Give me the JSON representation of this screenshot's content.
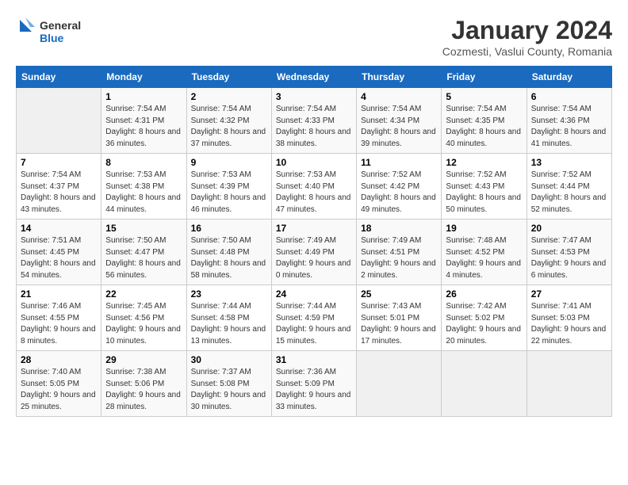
{
  "header": {
    "logo_general": "General",
    "logo_blue": "Blue",
    "title": "January 2024",
    "subtitle": "Cozmesti, Vaslui County, Romania"
  },
  "days_of_week": [
    "Sunday",
    "Monday",
    "Tuesday",
    "Wednesday",
    "Thursday",
    "Friday",
    "Saturday"
  ],
  "weeks": [
    [
      {
        "day": "",
        "sunrise": "",
        "sunset": "",
        "daylight": "",
        "empty": true
      },
      {
        "day": "1",
        "sunrise": "Sunrise: 7:54 AM",
        "sunset": "Sunset: 4:31 PM",
        "daylight": "Daylight: 8 hours and 36 minutes."
      },
      {
        "day": "2",
        "sunrise": "Sunrise: 7:54 AM",
        "sunset": "Sunset: 4:32 PM",
        "daylight": "Daylight: 8 hours and 37 minutes."
      },
      {
        "day": "3",
        "sunrise": "Sunrise: 7:54 AM",
        "sunset": "Sunset: 4:33 PM",
        "daylight": "Daylight: 8 hours and 38 minutes."
      },
      {
        "day": "4",
        "sunrise": "Sunrise: 7:54 AM",
        "sunset": "Sunset: 4:34 PM",
        "daylight": "Daylight: 8 hours and 39 minutes."
      },
      {
        "day": "5",
        "sunrise": "Sunrise: 7:54 AM",
        "sunset": "Sunset: 4:35 PM",
        "daylight": "Daylight: 8 hours and 40 minutes."
      },
      {
        "day": "6",
        "sunrise": "Sunrise: 7:54 AM",
        "sunset": "Sunset: 4:36 PM",
        "daylight": "Daylight: 8 hours and 41 minutes."
      }
    ],
    [
      {
        "day": "7",
        "sunrise": "Sunrise: 7:54 AM",
        "sunset": "Sunset: 4:37 PM",
        "daylight": "Daylight: 8 hours and 43 minutes."
      },
      {
        "day": "8",
        "sunrise": "Sunrise: 7:53 AM",
        "sunset": "Sunset: 4:38 PM",
        "daylight": "Daylight: 8 hours and 44 minutes."
      },
      {
        "day": "9",
        "sunrise": "Sunrise: 7:53 AM",
        "sunset": "Sunset: 4:39 PM",
        "daylight": "Daylight: 8 hours and 46 minutes."
      },
      {
        "day": "10",
        "sunrise": "Sunrise: 7:53 AM",
        "sunset": "Sunset: 4:40 PM",
        "daylight": "Daylight: 8 hours and 47 minutes."
      },
      {
        "day": "11",
        "sunrise": "Sunrise: 7:52 AM",
        "sunset": "Sunset: 4:42 PM",
        "daylight": "Daylight: 8 hours and 49 minutes."
      },
      {
        "day": "12",
        "sunrise": "Sunrise: 7:52 AM",
        "sunset": "Sunset: 4:43 PM",
        "daylight": "Daylight: 8 hours and 50 minutes."
      },
      {
        "day": "13",
        "sunrise": "Sunrise: 7:52 AM",
        "sunset": "Sunset: 4:44 PM",
        "daylight": "Daylight: 8 hours and 52 minutes."
      }
    ],
    [
      {
        "day": "14",
        "sunrise": "Sunrise: 7:51 AM",
        "sunset": "Sunset: 4:45 PM",
        "daylight": "Daylight: 8 hours and 54 minutes."
      },
      {
        "day": "15",
        "sunrise": "Sunrise: 7:50 AM",
        "sunset": "Sunset: 4:47 PM",
        "daylight": "Daylight: 8 hours and 56 minutes."
      },
      {
        "day": "16",
        "sunrise": "Sunrise: 7:50 AM",
        "sunset": "Sunset: 4:48 PM",
        "daylight": "Daylight: 8 hours and 58 minutes."
      },
      {
        "day": "17",
        "sunrise": "Sunrise: 7:49 AM",
        "sunset": "Sunset: 4:49 PM",
        "daylight": "Daylight: 9 hours and 0 minutes."
      },
      {
        "day": "18",
        "sunrise": "Sunrise: 7:49 AM",
        "sunset": "Sunset: 4:51 PM",
        "daylight": "Daylight: 9 hours and 2 minutes."
      },
      {
        "day": "19",
        "sunrise": "Sunrise: 7:48 AM",
        "sunset": "Sunset: 4:52 PM",
        "daylight": "Daylight: 9 hours and 4 minutes."
      },
      {
        "day": "20",
        "sunrise": "Sunrise: 7:47 AM",
        "sunset": "Sunset: 4:53 PM",
        "daylight": "Daylight: 9 hours and 6 minutes."
      }
    ],
    [
      {
        "day": "21",
        "sunrise": "Sunrise: 7:46 AM",
        "sunset": "Sunset: 4:55 PM",
        "daylight": "Daylight: 9 hours and 8 minutes."
      },
      {
        "day": "22",
        "sunrise": "Sunrise: 7:45 AM",
        "sunset": "Sunset: 4:56 PM",
        "daylight": "Daylight: 9 hours and 10 minutes."
      },
      {
        "day": "23",
        "sunrise": "Sunrise: 7:44 AM",
        "sunset": "Sunset: 4:58 PM",
        "daylight": "Daylight: 9 hours and 13 minutes."
      },
      {
        "day": "24",
        "sunrise": "Sunrise: 7:44 AM",
        "sunset": "Sunset: 4:59 PM",
        "daylight": "Daylight: 9 hours and 15 minutes."
      },
      {
        "day": "25",
        "sunrise": "Sunrise: 7:43 AM",
        "sunset": "Sunset: 5:01 PM",
        "daylight": "Daylight: 9 hours and 17 minutes."
      },
      {
        "day": "26",
        "sunrise": "Sunrise: 7:42 AM",
        "sunset": "Sunset: 5:02 PM",
        "daylight": "Daylight: 9 hours and 20 minutes."
      },
      {
        "day": "27",
        "sunrise": "Sunrise: 7:41 AM",
        "sunset": "Sunset: 5:03 PM",
        "daylight": "Daylight: 9 hours and 22 minutes."
      }
    ],
    [
      {
        "day": "28",
        "sunrise": "Sunrise: 7:40 AM",
        "sunset": "Sunset: 5:05 PM",
        "daylight": "Daylight: 9 hours and 25 minutes."
      },
      {
        "day": "29",
        "sunrise": "Sunrise: 7:38 AM",
        "sunset": "Sunset: 5:06 PM",
        "daylight": "Daylight: 9 hours and 28 minutes."
      },
      {
        "day": "30",
        "sunrise": "Sunrise: 7:37 AM",
        "sunset": "Sunset: 5:08 PM",
        "daylight": "Daylight: 9 hours and 30 minutes."
      },
      {
        "day": "31",
        "sunrise": "Sunrise: 7:36 AM",
        "sunset": "Sunset: 5:09 PM",
        "daylight": "Daylight: 9 hours and 33 minutes."
      },
      {
        "day": "",
        "sunrise": "",
        "sunset": "",
        "daylight": "",
        "empty": true
      },
      {
        "day": "",
        "sunrise": "",
        "sunset": "",
        "daylight": "",
        "empty": true
      },
      {
        "day": "",
        "sunrise": "",
        "sunset": "",
        "daylight": "",
        "empty": true
      }
    ]
  ]
}
